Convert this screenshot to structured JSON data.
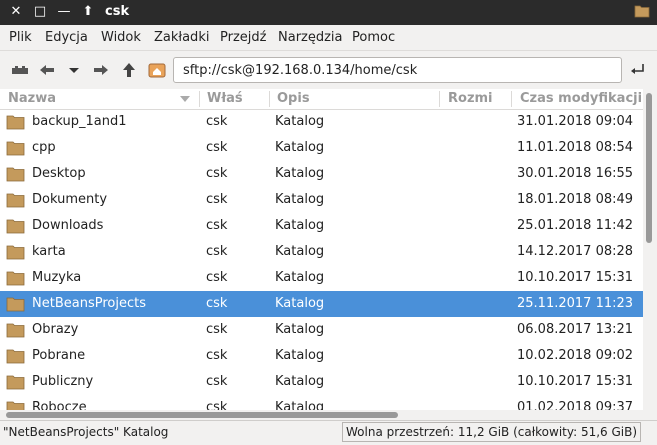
{
  "window": {
    "title": "csk",
    "close": "✕",
    "maximize": "□",
    "minimize": "—",
    "up": "⬆"
  },
  "menubar": {
    "items": [
      "Plik",
      "Edycja",
      "Widok",
      "Zakładki",
      "Przejdź",
      "Narzędzia",
      "Pomoc"
    ]
  },
  "toolbar": {
    "location": "sftp://csk@192.168.0.134/home/csk"
  },
  "columns": {
    "name": "Nazwa",
    "owner": "Właś",
    "desc": "Opis",
    "size": "Rozmi",
    "modified": "Czas modyfikacji"
  },
  "files": [
    {
      "name": "backup_1and1",
      "owner": "csk",
      "desc": "Katalog",
      "modified": "31.01.2018 09:04"
    },
    {
      "name": "cpp",
      "owner": "csk",
      "desc": "Katalog",
      "modified": "11.01.2018 08:54"
    },
    {
      "name": "Desktop",
      "owner": "csk",
      "desc": "Katalog",
      "modified": "30.01.2018 16:55"
    },
    {
      "name": "Dokumenty",
      "owner": "csk",
      "desc": "Katalog",
      "modified": "18.01.2018 08:49"
    },
    {
      "name": "Downloads",
      "owner": "csk",
      "desc": "Katalog",
      "modified": "25.01.2018 11:42"
    },
    {
      "name": "karta",
      "owner": "csk",
      "desc": "Katalog",
      "modified": "14.12.2017 08:28"
    },
    {
      "name": "Muzyka",
      "owner": "csk",
      "desc": "Katalog",
      "modified": "10.10.2017 15:31"
    },
    {
      "name": "NetBeansProjects",
      "owner": "csk",
      "desc": "Katalog",
      "modified": "25.11.2017 11:23",
      "selected": true
    },
    {
      "name": "Obrazy",
      "owner": "csk",
      "desc": "Katalog",
      "modified": "06.08.2017 13:21"
    },
    {
      "name": "Pobrane",
      "owner": "csk",
      "desc": "Katalog",
      "modified": "10.02.2018 09:02"
    },
    {
      "name": "Publiczny",
      "owner": "csk",
      "desc": "Katalog",
      "modified": "10.10.2017 15:31"
    },
    {
      "name": "Robocze",
      "owner": "csk",
      "desc": "Katalog",
      "modified": "01.02.2018 09:37"
    }
  ],
  "status": {
    "selection": "\"NetBeansProjects\" Katalog",
    "free_space": "Wolna przestrzeń: 11,2 GiB (całkowity: 51,6 GiB)"
  },
  "colors": {
    "selection": "#4a90d9",
    "folder": "#c49a5c",
    "titlebar": "#2b2b2b"
  },
  "icons": [
    "close-icon",
    "maximize-icon",
    "minimize-icon",
    "up-icon",
    "folder-icon",
    "connect-icon",
    "back-icon",
    "history-dropdown-icon",
    "forward-icon",
    "home-icon",
    "go-icon",
    "sort-arrow-icon"
  ]
}
